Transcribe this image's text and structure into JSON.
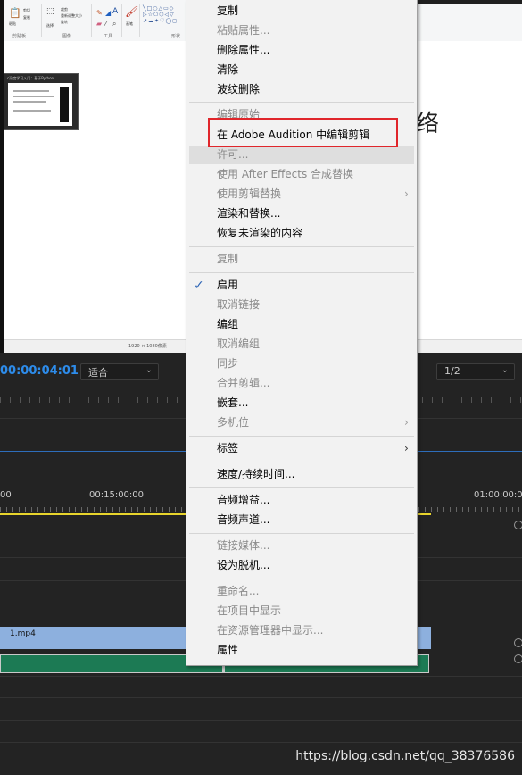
{
  "paint": {
    "ribbon_groups": [
      "剪贴板",
      "图像",
      "工具",
      "形状"
    ],
    "ribbon_tools": [
      "粘贴",
      "剪切",
      "复制",
      "选择",
      "裁剪",
      "重新调整大小",
      "旋转",
      "画笔"
    ],
    "status_text": "1920 × 1080像素",
    "thumbnail_title": "c深度学习入门：基于Python...",
    "canvas_char": "络"
  },
  "timeline": {
    "timecode": "00:00:04:01",
    "fit_dropdown": "适合",
    "resolution_dropdown": "1/2",
    "ruler_labels": [
      "00",
      "00:15:00:00",
      "01:00:00:0"
    ],
    "video_clip_label": "1.mp4",
    "watermark": "https://blog.csdn.net/qq_38376586"
  },
  "context_menu": {
    "items": [
      {
        "label": "复制",
        "enabled": true
      },
      {
        "label": "粘贴属性...",
        "enabled": false
      },
      {
        "label": "删除属性...",
        "enabled": true
      },
      {
        "label": "清除",
        "enabled": true
      },
      {
        "label": "波纹删除",
        "enabled": true
      },
      {
        "label": "编辑原始",
        "enabled": false
      },
      {
        "label": "在 Adobe Audition 中编辑剪辑",
        "enabled": true,
        "highlighted": true
      },
      {
        "label": "许可...",
        "enabled": false,
        "hover": true
      },
      {
        "label": "使用 After Effects 合成替换",
        "enabled": false
      },
      {
        "label": "使用剪辑替换",
        "enabled": false,
        "submenu": true
      },
      {
        "label": "渲染和替换...",
        "enabled": true
      },
      {
        "label": "恢复未渲染的内容",
        "enabled": true
      },
      {
        "label": "复制",
        "enabled": false
      },
      {
        "label": "启用",
        "enabled": true,
        "checked": true
      },
      {
        "label": "取消链接",
        "enabled": false
      },
      {
        "label": "编组",
        "enabled": true
      },
      {
        "label": "取消编组",
        "enabled": false
      },
      {
        "label": "同步",
        "enabled": false
      },
      {
        "label": "合并剪辑...",
        "enabled": false
      },
      {
        "label": "嵌套...",
        "enabled": true
      },
      {
        "label": "多机位",
        "enabled": false,
        "submenu": true
      },
      {
        "label": "标签",
        "enabled": true,
        "submenu": true
      },
      {
        "label": "速度/持续时间...",
        "enabled": true
      },
      {
        "label": "音频增益...",
        "enabled": true
      },
      {
        "label": "音频声道...",
        "enabled": true
      },
      {
        "label": "链接媒体...",
        "enabled": false
      },
      {
        "label": "设为脱机...",
        "enabled": true
      },
      {
        "label": "重命名...",
        "enabled": false
      },
      {
        "label": "在项目中显示",
        "enabled": false
      },
      {
        "label": "在资源管理器中显示...",
        "enabled": false
      },
      {
        "label": "属性",
        "enabled": true
      }
    ],
    "submenu_arrow": "›",
    "check_glyph": "✓"
  },
  "colors": {
    "timecode": "#2d8ceb",
    "highlight_border": "#e0262b",
    "check": "#2b63b5",
    "video_clip": "#8db0de",
    "audio_clip": "#1c7a54",
    "playhead_bar": "#e8d42c"
  }
}
